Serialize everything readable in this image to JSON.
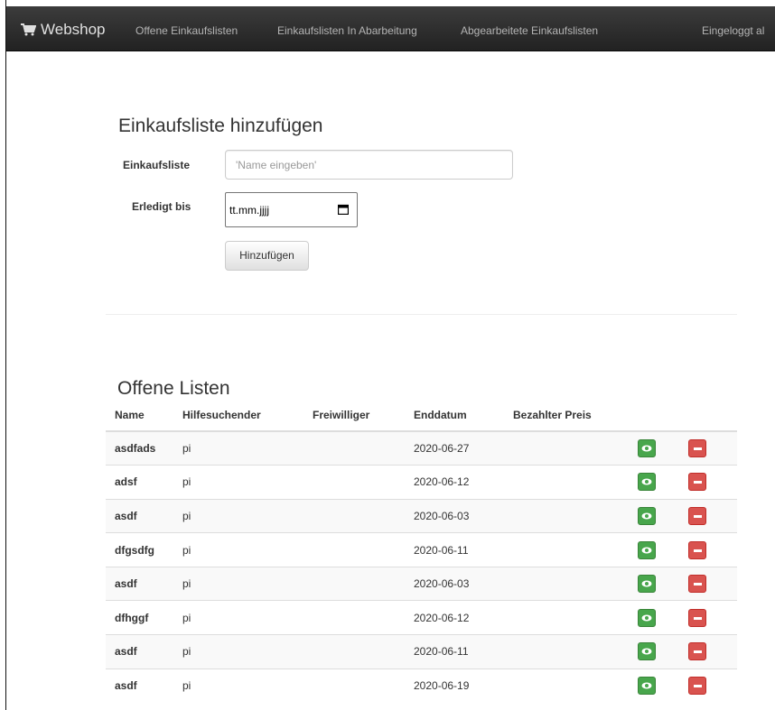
{
  "navbar": {
    "brand": "Webshop",
    "links": [
      "Offene Einkaufslisten",
      "Einkaufslisten In Abarbeitung",
      "Abgearbeitete Einkaufslisten"
    ],
    "user_status": "Eingeloggt al"
  },
  "add_form": {
    "title": "Einkaufsliste hinzufügen",
    "name_label": "Einkaufsliste",
    "name_placeholder": "'Name eingeben'",
    "date_label": "Erledigt bis",
    "date_placeholder": "tt.mm.jjjj",
    "submit_label": "Hinzufügen"
  },
  "open_lists": {
    "title": "Offene Listen",
    "columns": [
      "Name",
      "Hilfesuchender",
      "Freiwilliger",
      "Enddatum",
      "Bezahlter Preis"
    ],
    "rows": [
      {
        "name": "asdfads",
        "hilfesuchender": "pi",
        "freiwilliger": "",
        "enddatum": "2020-06-27",
        "preis": ""
      },
      {
        "name": "adsf",
        "hilfesuchender": "pi",
        "freiwilliger": "",
        "enddatum": "2020-06-12",
        "preis": ""
      },
      {
        "name": "asdf",
        "hilfesuchender": "pi",
        "freiwilliger": "",
        "enddatum": "2020-06-03",
        "preis": ""
      },
      {
        "name": "dfgsdfg",
        "hilfesuchender": "pi",
        "freiwilliger": "",
        "enddatum": "2020-06-11",
        "preis": ""
      },
      {
        "name": "asdf",
        "hilfesuchender": "pi",
        "freiwilliger": "",
        "enddatum": "2020-06-03",
        "preis": ""
      },
      {
        "name": "dfhggf",
        "hilfesuchender": "pi",
        "freiwilliger": "",
        "enddatum": "2020-06-12",
        "preis": ""
      },
      {
        "name": "asdf",
        "hilfesuchender": "pi",
        "freiwilliger": "",
        "enddatum": "2020-06-11",
        "preis": ""
      },
      {
        "name": "asdf",
        "hilfesuchender": "pi",
        "freiwilliger": "",
        "enddatum": "2020-06-19",
        "preis": ""
      }
    ]
  },
  "icons": {
    "brand": "shopping-cart-icon",
    "calendar": "calendar-icon",
    "view": "eye-icon",
    "delete": "minus-icon"
  },
  "colors": {
    "navbar": "#222222",
    "view_button": "#48a64c",
    "delete_button": "#d9534f"
  }
}
